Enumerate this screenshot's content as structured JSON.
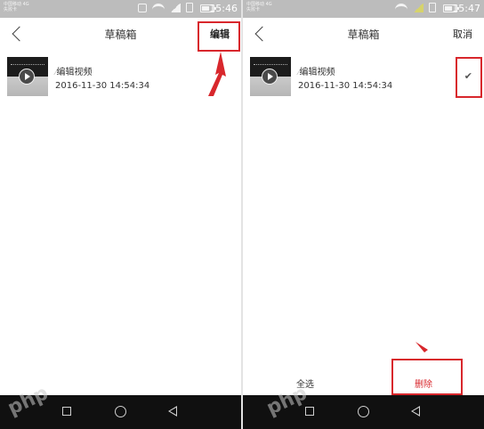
{
  "left": {
    "status": {
      "carrier_line1": "中国移动 4G",
      "carrier_line2": "失败卡",
      "time": "15:46",
      "battery_level": 0.55
    },
    "header": {
      "title": "草稿箱",
      "action_label": "编辑"
    },
    "draft": {
      "name": "编辑视频",
      "date": "2016-11-30 14:54:34"
    },
    "watermark": "php"
  },
  "right": {
    "status": {
      "carrier_line1": "中国移动 4G",
      "carrier_line2": "失败卡",
      "time": "15:47",
      "battery_level": 0.55
    },
    "header": {
      "title": "草稿箱",
      "action_label": "取消"
    },
    "draft": {
      "name": "编辑视频",
      "date": "2016-11-30 14:54:34",
      "check": "✔"
    },
    "bottom": {
      "select_all": "全选",
      "delete": "删除"
    },
    "watermark": "php"
  },
  "colors": {
    "annotation": "#d8272c",
    "statusbar": "#bcbcbc",
    "navbar": "#101010"
  },
  "icons": [
    "back-chevron-icon",
    "play-icon",
    "wifi-icon",
    "battery-icon",
    "nav-back-icon",
    "nav-home-icon",
    "nav-recents-icon",
    "checkmark-icon"
  ]
}
